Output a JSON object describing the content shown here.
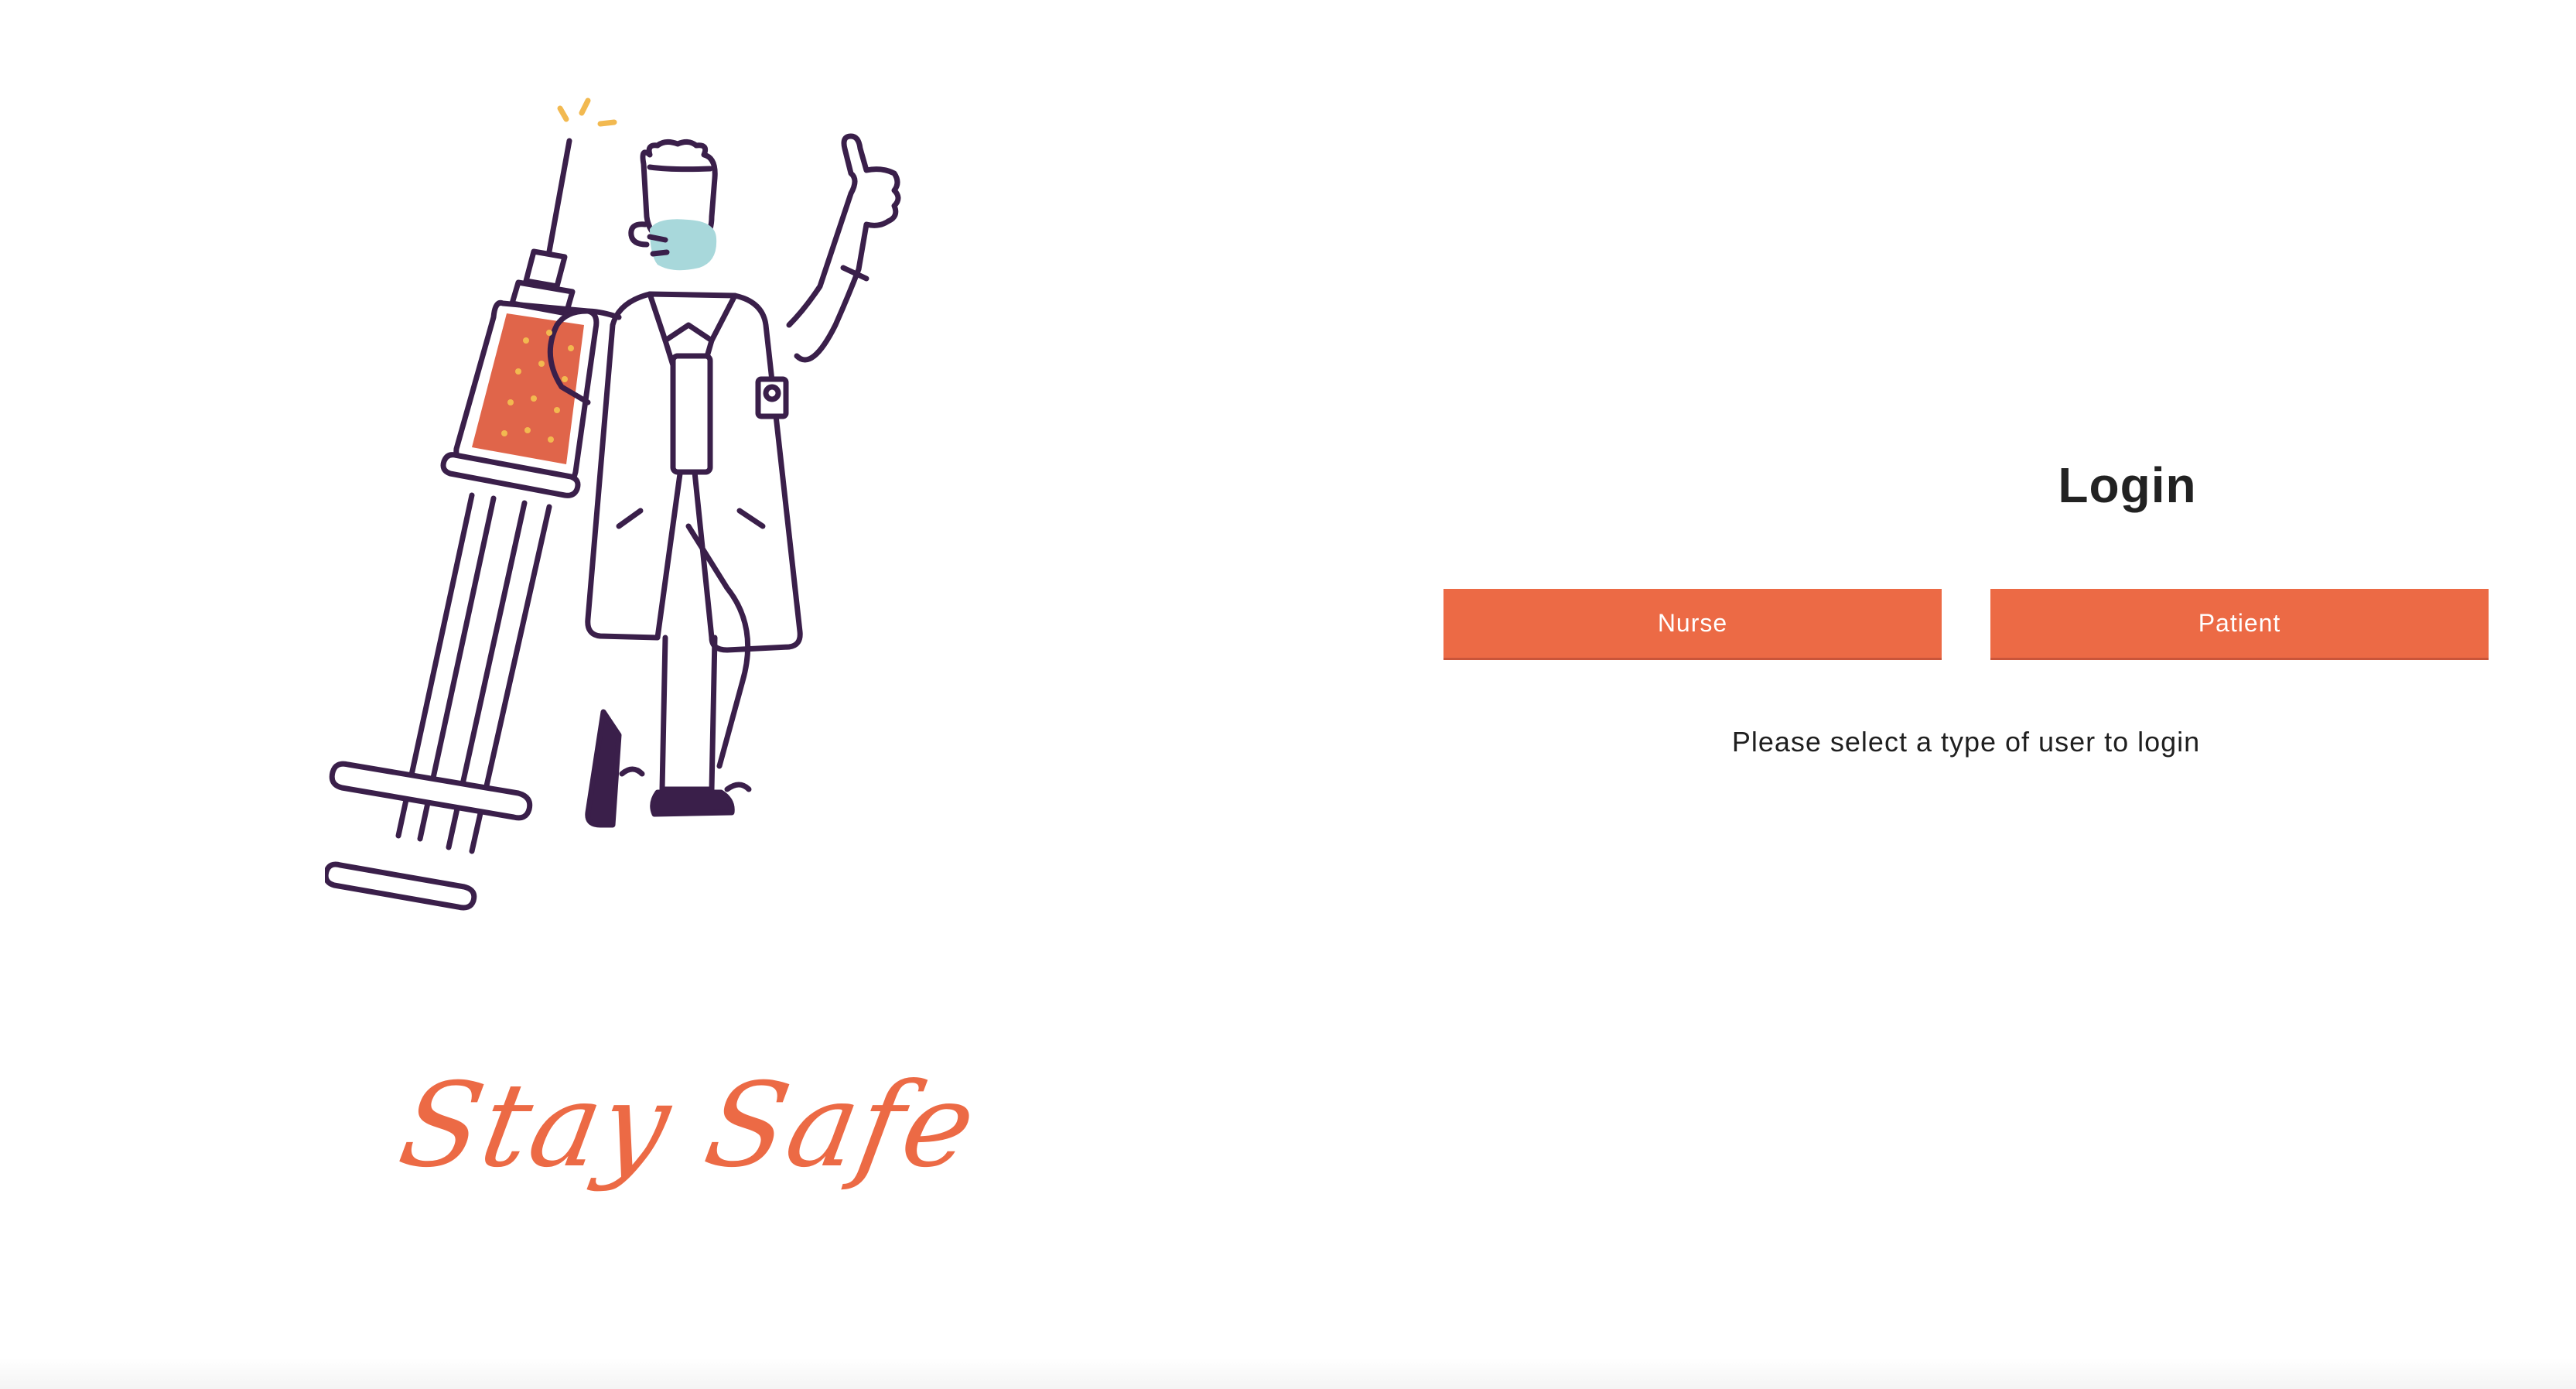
{
  "illustration": {
    "icon": "doctor-with-syringe-illustration",
    "colors": {
      "line": "#3a1f4a",
      "syringe_fill": "#e0654a",
      "mask": "#a8d8db",
      "accent": "#f2b950"
    }
  },
  "tagline": "Stay Safe",
  "login": {
    "title": "Login",
    "nurse_label": "Nurse",
    "patient_label": "Patient",
    "hint": "Please select a type of user to login"
  },
  "colors": {
    "accent": "#ec6a45",
    "text": "#222222",
    "background": "#ffffff"
  }
}
